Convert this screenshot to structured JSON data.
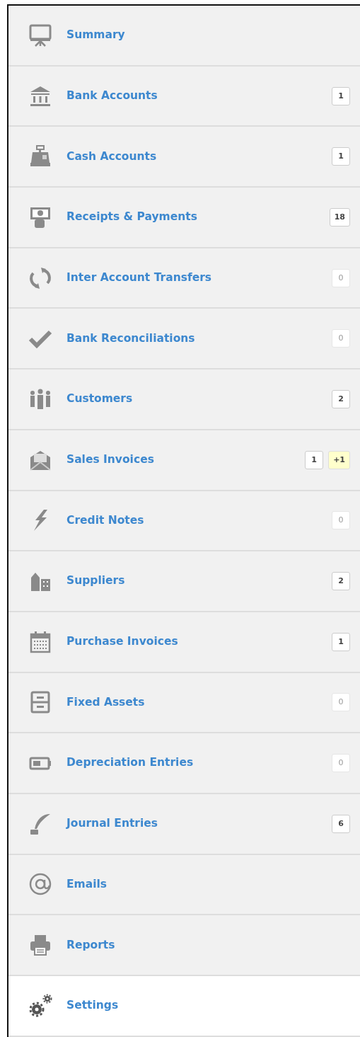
{
  "sidebar": {
    "items": [
      {
        "label": "Summary",
        "selected": false
      },
      {
        "label": "Bank Accounts",
        "selected": false,
        "badges": [
          {
            "text": "1",
            "kind": "count",
            "dimmed": false
          }
        ]
      },
      {
        "label": "Cash Accounts",
        "selected": false,
        "badges": [
          {
            "text": "1",
            "kind": "count",
            "dimmed": false
          }
        ]
      },
      {
        "label": "Receipts & Payments",
        "selected": false,
        "badges": [
          {
            "text": "18",
            "kind": "count",
            "dimmed": false
          }
        ]
      },
      {
        "label": "Inter Account Transfers",
        "selected": false,
        "badges": [
          {
            "text": "0",
            "kind": "count",
            "dimmed": true
          }
        ]
      },
      {
        "label": "Bank Reconciliations",
        "selected": false,
        "badges": [
          {
            "text": "0",
            "kind": "count",
            "dimmed": true
          }
        ]
      },
      {
        "label": "Customers",
        "selected": false,
        "badges": [
          {
            "text": "2",
            "kind": "count",
            "dimmed": false
          }
        ]
      },
      {
        "label": "Sales Invoices",
        "selected": false,
        "badges": [
          {
            "text": "1",
            "kind": "count",
            "dimmed": false
          },
          {
            "text": "+1",
            "kind": "new",
            "dimmed": false
          }
        ]
      },
      {
        "label": "Credit Notes",
        "selected": false,
        "badges": [
          {
            "text": "0",
            "kind": "count",
            "dimmed": true
          }
        ]
      },
      {
        "label": "Suppliers",
        "selected": false,
        "badges": [
          {
            "text": "2",
            "kind": "count",
            "dimmed": false
          }
        ]
      },
      {
        "label": "Purchase Invoices",
        "selected": false,
        "badges": [
          {
            "text": "1",
            "kind": "count",
            "dimmed": false
          }
        ]
      },
      {
        "label": "Fixed Assets",
        "selected": false,
        "badges": [
          {
            "text": "0",
            "kind": "count",
            "dimmed": true
          }
        ]
      },
      {
        "label": "Depreciation Entries",
        "selected": false,
        "badges": [
          {
            "text": "0",
            "kind": "count",
            "dimmed": true
          }
        ]
      },
      {
        "label": "Journal Entries",
        "selected": false,
        "badges": [
          {
            "text": "6",
            "kind": "count",
            "dimmed": false
          }
        ]
      },
      {
        "label": "Emails",
        "selected": false
      },
      {
        "label": "Reports",
        "selected": false
      },
      {
        "label": "Settings",
        "selected": true
      }
    ]
  }
}
